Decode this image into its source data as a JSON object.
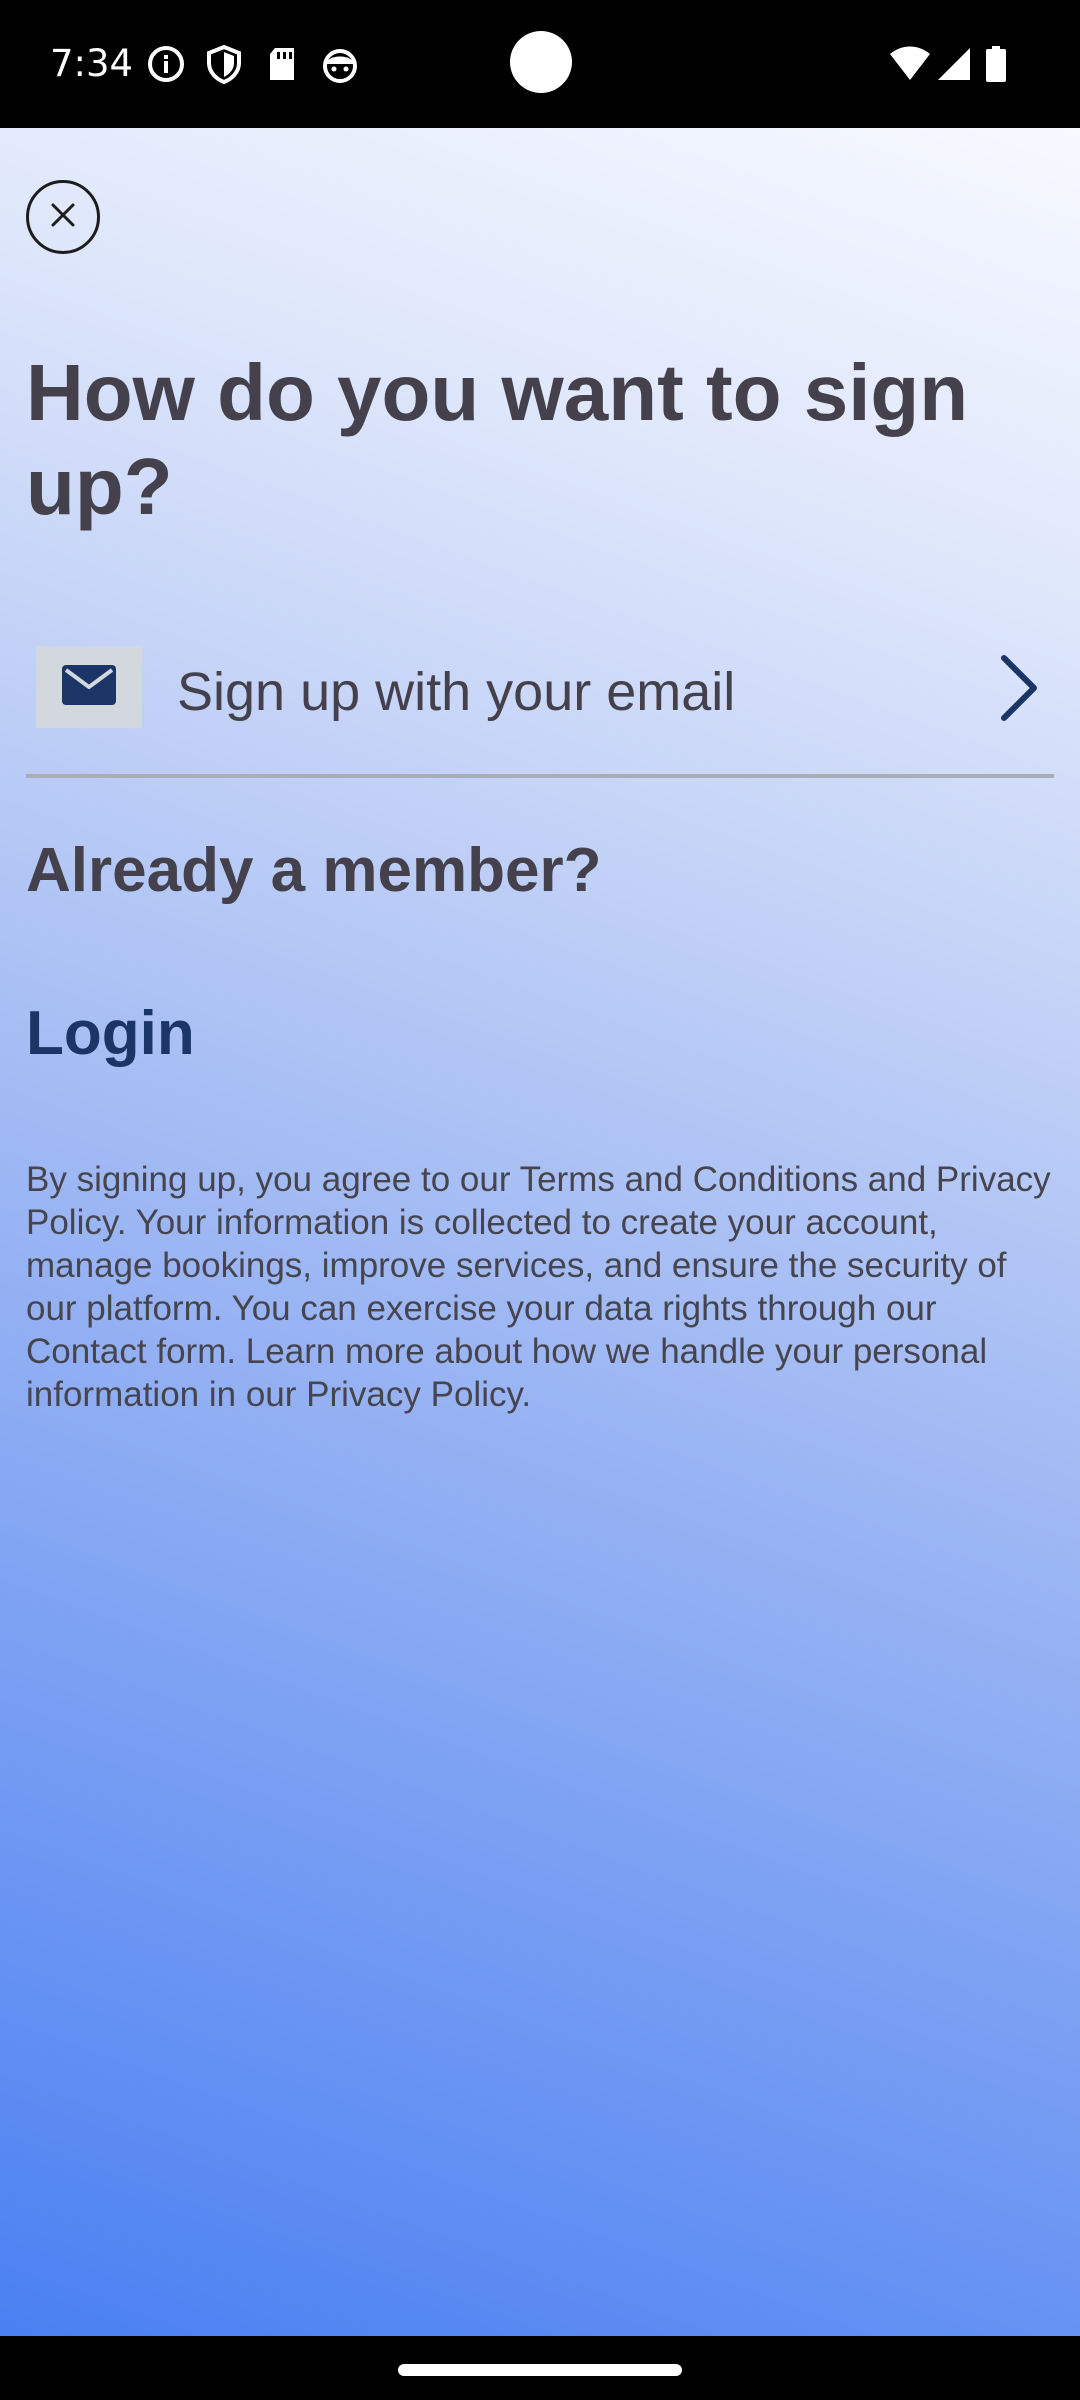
{
  "status_bar": {
    "time": "7:34",
    "icons": [
      "info-icon",
      "shield-icon",
      "sd-card-icon",
      "android-face-icon",
      "wifi-icon",
      "signal-icon",
      "battery-icon"
    ]
  },
  "sheet": {
    "close_icon": "close-icon",
    "title": "How do you want to sign up?",
    "email_option": {
      "icon": "mail-icon",
      "label": "Sign up with your email",
      "chevron": "chevron-right-icon"
    },
    "already_member": "Already a member?",
    "login_label": "Login",
    "legal_text": "By signing up, you agree to our Terms and Conditions and Privacy Policy. Your information is collected to create your account, manage bookings, improve services, and ensure the security of our platform. You can exercise your data rights through our Contact form. Learn more about how we handle your personal information in our Privacy Policy."
  },
  "colors": {
    "title_text": "#44414c",
    "link": "#1b3566",
    "mail_icon": "#1b3566",
    "gradient_bottom": "#4a80f2"
  }
}
